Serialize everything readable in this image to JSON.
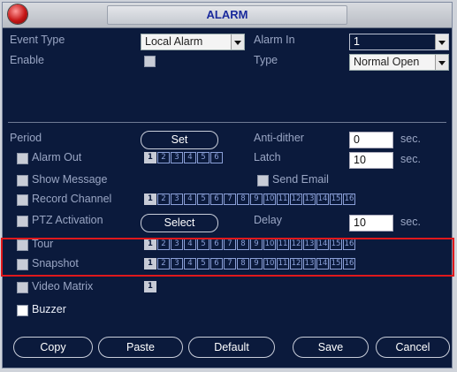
{
  "window": {
    "title": "ALARM"
  },
  "form": {
    "event_type_label": "Event Type",
    "event_type_value": "Local Alarm",
    "alarm_in_label": "Alarm In",
    "alarm_in_value": "1",
    "enable_label": "Enable",
    "type_label": "Type",
    "type_value": "Normal Open",
    "period_label": "Period",
    "set_label": "Set",
    "anti_dither_label": "Anti-dither",
    "anti_dither_value": "0",
    "anti_dither_unit": "sec.",
    "alarm_out_label": "Alarm Out",
    "alarm_out_channels": [
      "1",
      "2",
      "3",
      "4",
      "5",
      "6"
    ],
    "latch_label": "Latch",
    "latch_value": "10",
    "latch_unit": "sec.",
    "show_message_label": "Show Message",
    "send_email_label": "Send Email",
    "record_channel_label": "Record Channel",
    "record_channels": [
      "1",
      "2",
      "3",
      "4",
      "5",
      "6",
      "7",
      "8",
      "9",
      "10",
      "11",
      "12",
      "13",
      "14",
      "15",
      "16"
    ],
    "ptz_activation_label": "PTZ Activation",
    "select_label": "Select",
    "delay_label": "Delay",
    "delay_value": "10",
    "delay_unit": "sec.",
    "tour_label": "Tour",
    "tour_channels": [
      "1",
      "2",
      "3",
      "4",
      "5",
      "6",
      "7",
      "8",
      "9",
      "10",
      "11",
      "12",
      "13",
      "14",
      "15",
      "16"
    ],
    "snapshot_label": "Snapshot",
    "snapshot_channels": [
      "1",
      "2",
      "3",
      "4",
      "5",
      "6",
      "7",
      "8",
      "9",
      "10",
      "11",
      "12",
      "13",
      "14",
      "15",
      "16"
    ],
    "video_matrix_label": "Video Matrix",
    "video_matrix_channel": "1",
    "buzzer_label": "Buzzer"
  },
  "buttons": {
    "copy": "Copy",
    "paste": "Paste",
    "default": "Default",
    "save": "Save",
    "cancel": "Cancel"
  },
  "colors": {
    "background": "#0b1a3c",
    "title_text": "#1a2a9c",
    "highlight": "#e0181c"
  }
}
